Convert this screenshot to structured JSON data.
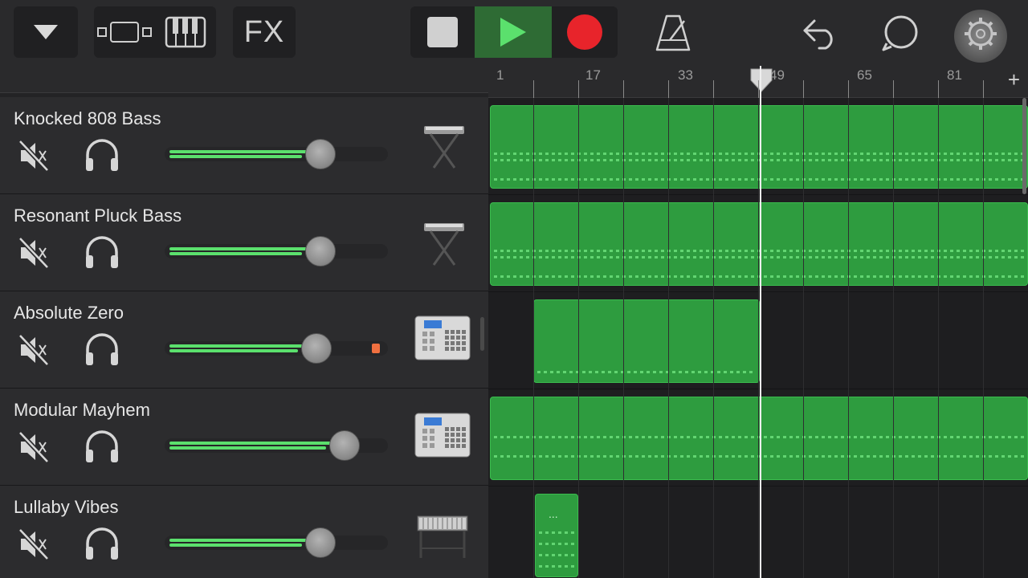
{
  "toolbar": {
    "menu_icon": "triangle-down-icon",
    "view_icon": "tracks-view-icon",
    "keyboard_icon": "piano-keyboard-icon",
    "fx_label": "FX",
    "stop_icon": "stop-icon",
    "play_icon": "play-icon",
    "record_icon": "record-icon",
    "metronome_icon": "metronome-icon",
    "undo_icon": "undo-icon",
    "loop_icon": "loop-browser-icon",
    "settings_icon": "settings-gear-icon"
  },
  "ruler": {
    "bars": [
      "1",
      "17",
      "33",
      "49",
      "65",
      "81"
    ],
    "add_label": "+"
  },
  "colors": {
    "region_green": "#2e9c3f",
    "volume_green": "#5be06d",
    "record_red": "#e8242b",
    "play_green": "#5be06d"
  },
  "tracks": [
    {
      "name": "Knocked 808 Bass",
      "muted": true,
      "volume": 0.7,
      "instrument_icon": "synth-keyboard-icon"
    },
    {
      "name": "Resonant Pluck Bass",
      "muted": true,
      "volume": 0.7,
      "instrument_icon": "synth-keyboard-icon"
    },
    {
      "name": "Absolute Zero",
      "muted": true,
      "volume": 0.68,
      "instrument_icon": "drum-machine-icon",
      "clip": true
    },
    {
      "name": "Modular Mayhem",
      "muted": true,
      "volume": 0.81,
      "instrument_icon": "drum-machine-icon"
    },
    {
      "name": "Lullaby Vibes",
      "muted": true,
      "volume": 0.7,
      "instrument_icon": "vibraphone-icon"
    }
  ],
  "region_label": "..."
}
